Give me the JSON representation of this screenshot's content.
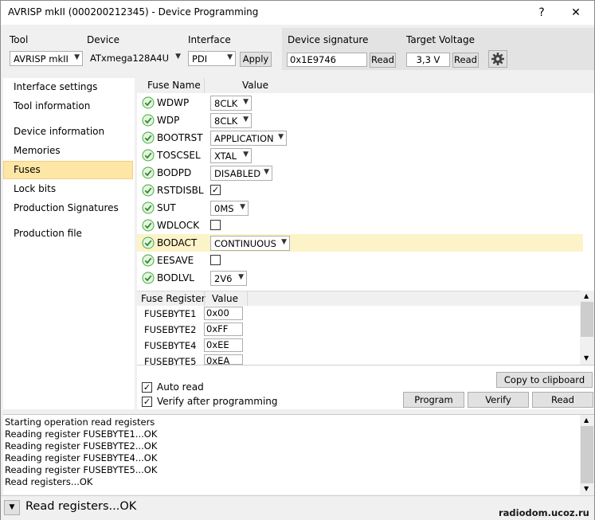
{
  "window": {
    "title": "AVRISP mkII (000200212345) - Device Programming",
    "help_label": "?",
    "close_label": "✕"
  },
  "toolbar": {
    "tool_label": "Tool",
    "tool_value": "AVRISP mkII",
    "device_label": "Device",
    "device_value": "ATxmega128A4U",
    "interface_label": "Interface",
    "interface_value": "PDI",
    "apply_label": "Apply",
    "signature_label": "Device signature",
    "signature_value": "0x1E9746",
    "signature_read_label": "Read",
    "voltage_label": "Target Voltage",
    "voltage_value": "3,3 V",
    "voltage_read_label": "Read",
    "settings_icon": "gear-icon"
  },
  "nav": {
    "items": [
      {
        "label": "Interface settings"
      },
      {
        "label": "Tool information"
      },
      {
        "label": "Device information"
      },
      {
        "label": "Memories"
      },
      {
        "label": "Fuses"
      },
      {
        "label": "Lock bits"
      },
      {
        "label": "Production Signatures"
      },
      {
        "label": "Production file"
      }
    ],
    "selected": "Fuses",
    "selected_color": "#fde6a6"
  },
  "fuses": {
    "col_name": "Fuse Name",
    "col_value": "Value",
    "rows": [
      {
        "name": "WDWP",
        "value": "8CLK"
      },
      {
        "name": "WDP",
        "value": "8CLK"
      },
      {
        "name": "BOOTRST",
        "value": "APPLICATION"
      },
      {
        "name": "TOSCSEL",
        "value": "XTAL"
      },
      {
        "name": "BODPD",
        "value": "DISABLED"
      },
      {
        "name": "RSTDISBL",
        "value": "✓"
      },
      {
        "name": "SUT",
        "value": "0MS"
      },
      {
        "name": "WDLOCK",
        "value": ""
      },
      {
        "name": "BODACT",
        "value": "CONTINUOUS"
      },
      {
        "name": "EESAVE",
        "value": ""
      },
      {
        "name": "BODLVL",
        "value": "2V6"
      }
    ],
    "status_icon": "check-circle-icon",
    "status_color": "#3fae3f",
    "highlight_color": "#fdf3c9"
  },
  "registers": {
    "col_name": "Fuse Register",
    "col_value": "Value",
    "rows": [
      {
        "name": "FUSEBYTE1",
        "value": "0x00"
      },
      {
        "name": "FUSEBYTE2",
        "value": "0xFF"
      },
      {
        "name": "FUSEBYTE4",
        "value": "0xEE"
      },
      {
        "name": "FUSEBYTE5",
        "value": "0xEA"
      }
    ]
  },
  "options": {
    "copy_label": "Copy to clipboard",
    "auto_read_label": "Auto read",
    "auto_read_checked": "✓",
    "verify_after_label": "Verify after programming",
    "verify_after_checked": "✓",
    "program_label": "Program",
    "verify_label": "Verify",
    "read_label": "Read"
  },
  "log": {
    "lines": [
      "Starting operation read registers",
      "Reading register FUSEBYTE1...OK",
      "Reading register FUSEBYTE2...OK",
      "Reading register FUSEBYTE4...OK",
      "Reading register FUSEBYTE5...OK",
      "Read registers...OK"
    ]
  },
  "status": {
    "text": "Read registers...OK",
    "toggle_icon": "chevron-down-icon"
  },
  "watermark": "radiodom.ucoz.ru"
}
